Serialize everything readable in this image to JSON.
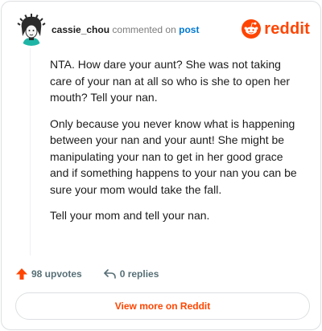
{
  "comment": {
    "username": "cassie_chou",
    "action": "commented on",
    "post_link": "post",
    "paragraphs": [
      "NTA. How dare your aunt? She was not taking care of your nan at all so who is she to open her mouth? Tell your nan.",
      "Only because you never know what is happening between your nan and your aunt! She might be manipulating your nan to get in her good grace and if something happens to your nan you can be sure your mom would take the fall.",
      "Tell your mom and tell your nan."
    ]
  },
  "brand": {
    "name": "reddit",
    "color": "#ff4500"
  },
  "stats": {
    "upvotes": "98 upvotes",
    "replies": "0 replies"
  },
  "icons": {
    "upvote": "upvote-arrow-icon",
    "reply": "reply-icon",
    "logo": "reddit-snoo-icon"
  },
  "footer": {
    "view_more": "View more on Reddit"
  }
}
